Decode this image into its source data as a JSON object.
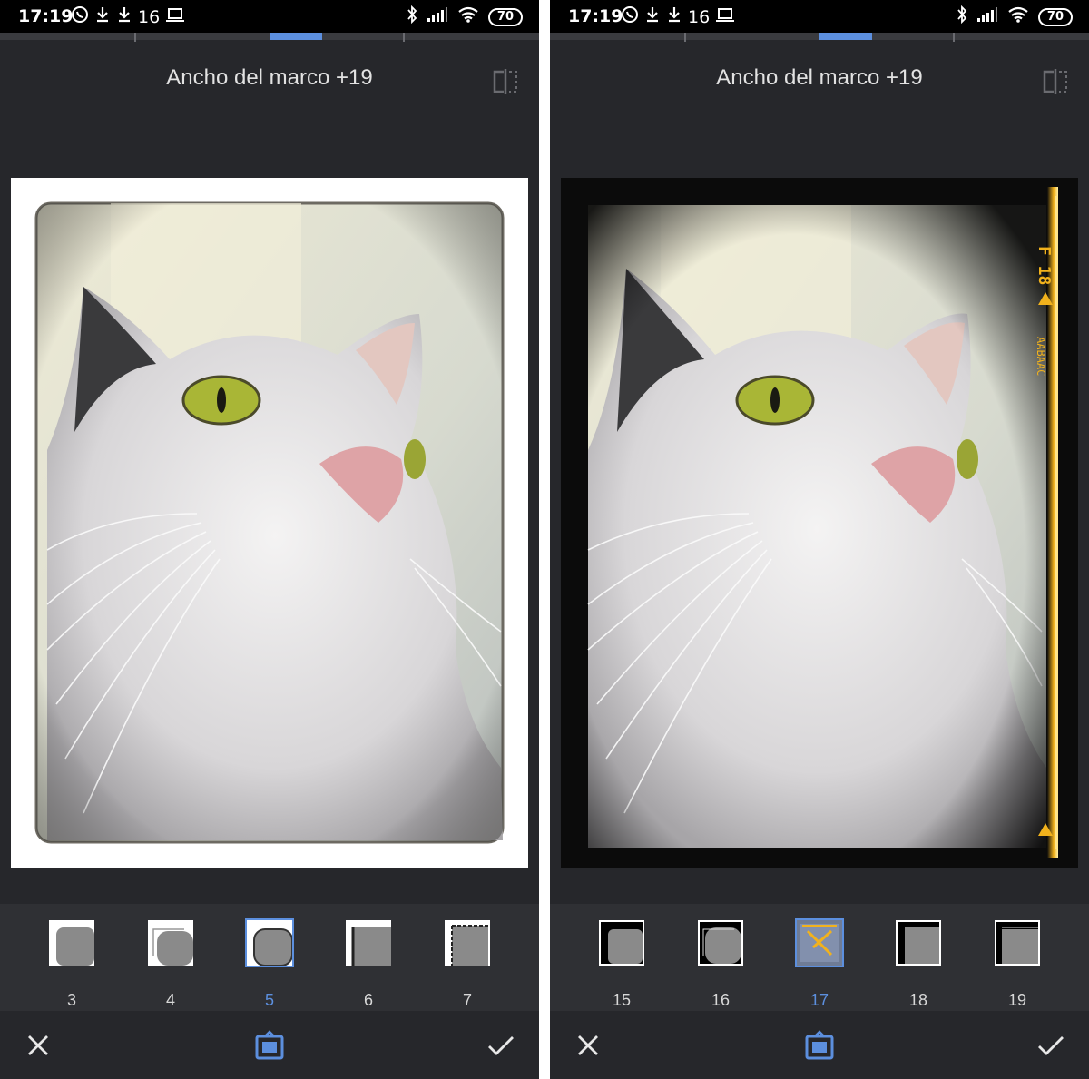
{
  "screens": [
    {
      "status": {
        "time": "17:19",
        "notification_count": "16",
        "battery": "70",
        "left_icons": [
          "whatsapp-icon",
          "download-icon",
          "download-icon",
          "laptop-icon"
        ],
        "right_icons": [
          "bluetooth-icon",
          "signal-icon",
          "wifi-icon"
        ]
      },
      "title": "Ancho del marco +19",
      "frame_style": "white-border",
      "thumbnails": [
        {
          "label": "3",
          "selected": false
        },
        {
          "label": "4",
          "selected": false
        },
        {
          "label": "5",
          "selected": true
        },
        {
          "label": "6",
          "selected": false
        },
        {
          "label": "7",
          "selected": false
        }
      ],
      "actions": {
        "cancel_icon": "close-icon",
        "center_icon": "frame-style-icon",
        "apply_icon": "check-icon"
      }
    },
    {
      "status": {
        "time": "17:19",
        "notification_count": "16",
        "battery": "70",
        "left_icons": [
          "whatsapp-icon",
          "download-icon",
          "download-icon",
          "laptop-icon"
        ],
        "right_icons": [
          "bluetooth-icon",
          "signal-icon",
          "wifi-icon"
        ]
      },
      "title": "Ancho del marco +19",
      "frame_style": "film-border",
      "film_text": {
        "top": "F 18",
        "middle": "AABAAC"
      },
      "thumbnails": [
        {
          "label": "15",
          "selected": false
        },
        {
          "label": "16",
          "selected": false
        },
        {
          "label": "17",
          "selected": true
        },
        {
          "label": "18",
          "selected": false
        },
        {
          "label": "19",
          "selected": false
        }
      ],
      "actions": {
        "cancel_icon": "close-icon",
        "center_icon": "frame-style-icon",
        "apply_icon": "check-icon"
      }
    }
  ],
  "colors": {
    "accent": "#5c8fde",
    "background": "#26272b",
    "thumb_bar": "#2f3034",
    "film_edge": "#f2b21c"
  }
}
